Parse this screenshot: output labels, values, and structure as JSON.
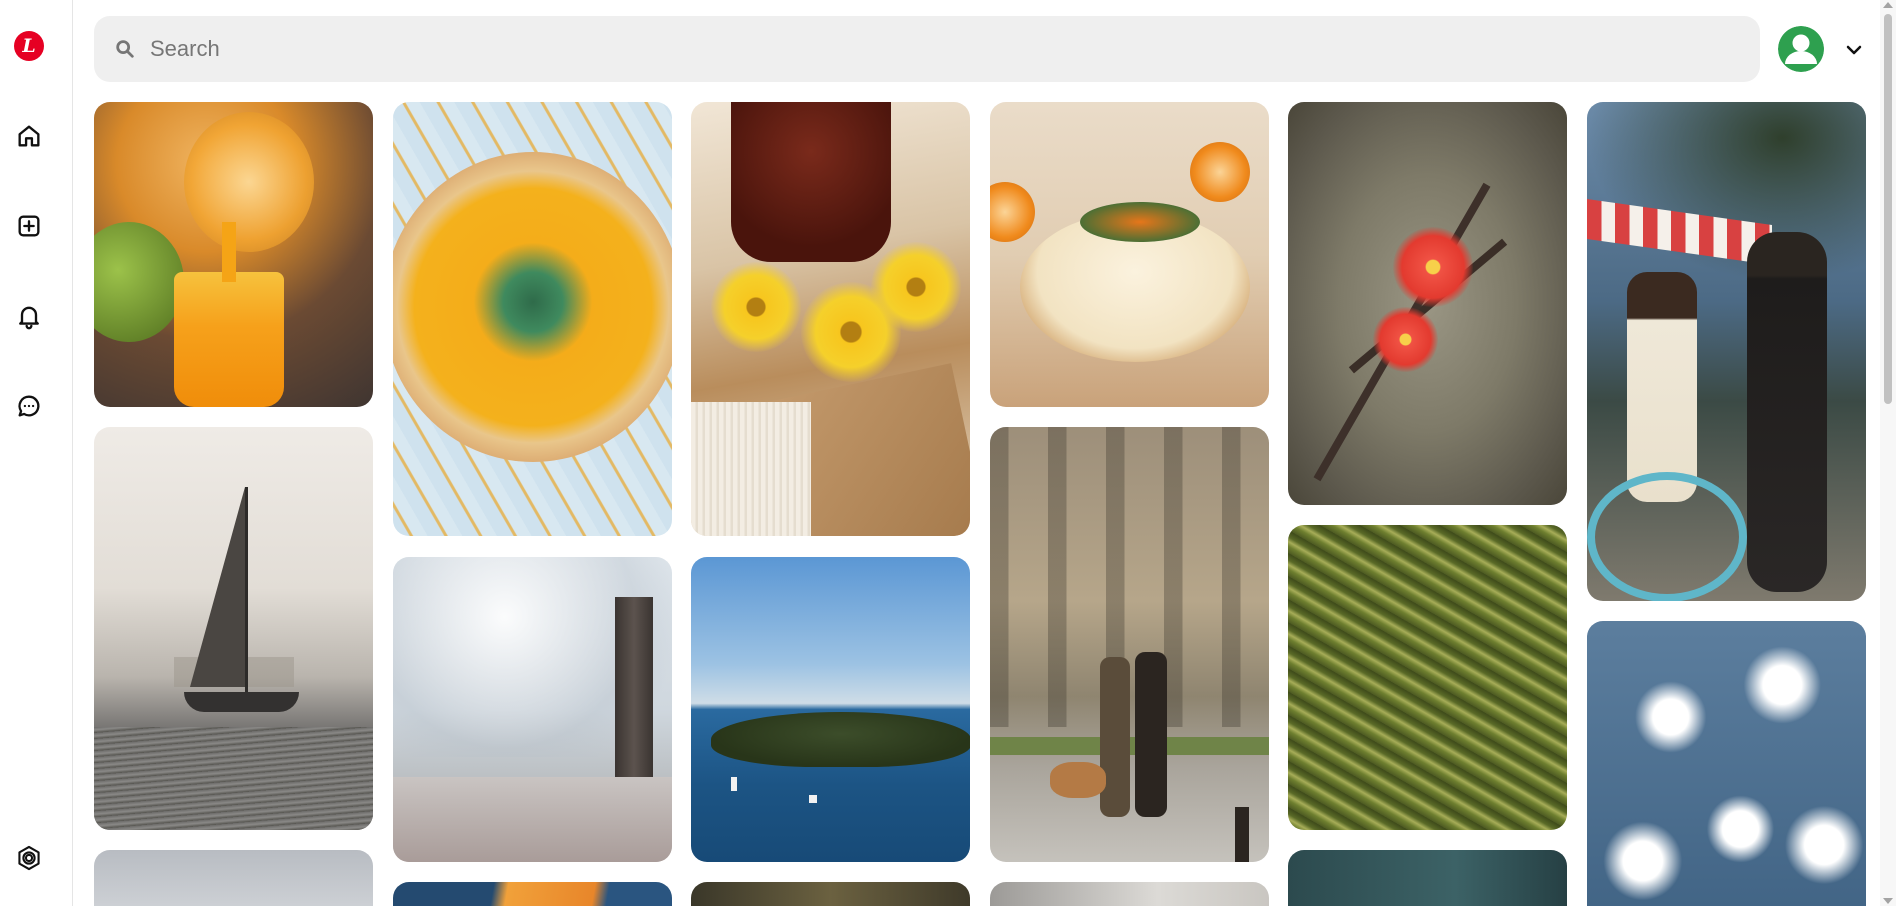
{
  "app": {
    "logo_letter": "L",
    "brand_color": "#e60023"
  },
  "sidebar": {
    "items": [
      {
        "name": "home",
        "icon": "home-icon"
      },
      {
        "name": "create",
        "icon": "plus-square-icon"
      },
      {
        "name": "notifications",
        "icon": "bell-icon"
      },
      {
        "name": "messages",
        "icon": "chat-icon"
      },
      {
        "name": "settings",
        "icon": "settings-hexagon-icon"
      }
    ]
  },
  "search": {
    "placeholder": "Search",
    "icon": "search-icon"
  },
  "profile": {
    "avatar_icon": "user-avatar-icon",
    "avatar_color": "#2ea04f",
    "menu_icon": "chevron-down-icon"
  },
  "pins": [
    {
      "id": "orange-juice"
    },
    {
      "id": "sailboat"
    },
    {
      "id": "gray-sky"
    },
    {
      "id": "pumpkin-soup"
    },
    {
      "id": "frosted-trees"
    },
    {
      "id": "orange-partial"
    },
    {
      "id": "tea-flowers"
    },
    {
      "id": "island-sea"
    },
    {
      "id": "dark-partial"
    },
    {
      "id": "cheesecake"
    },
    {
      "id": "couple-dog"
    },
    {
      "id": "gray-partial"
    },
    {
      "id": "red-blossom"
    },
    {
      "id": "wheat-field"
    },
    {
      "id": "teal-partial"
    },
    {
      "id": "pedicab-couple"
    },
    {
      "id": "snowy-forest"
    }
  ]
}
